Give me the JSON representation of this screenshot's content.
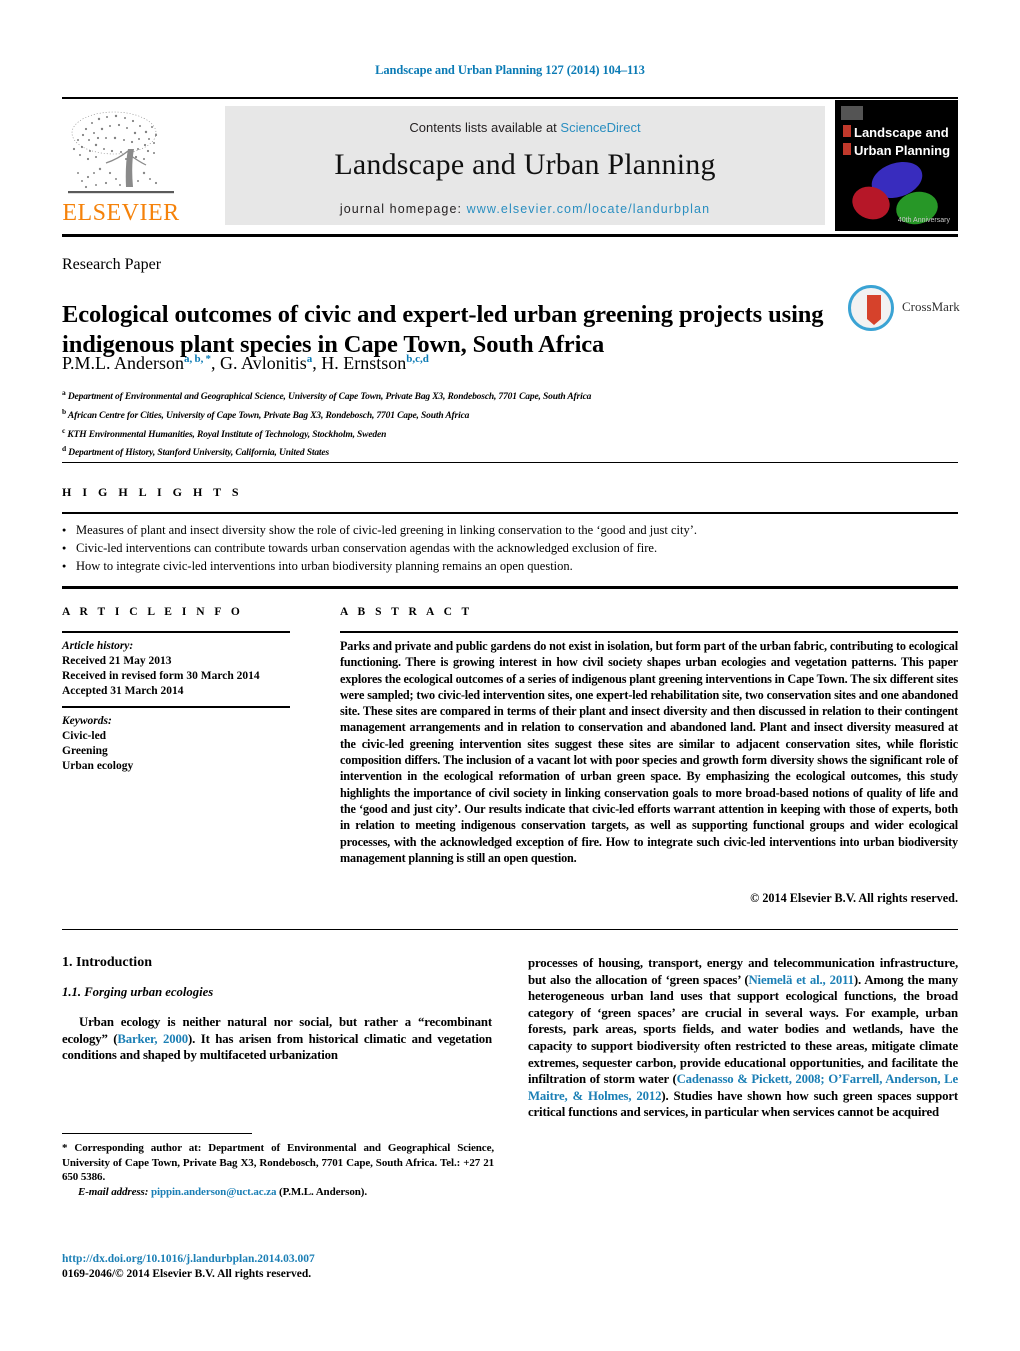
{
  "running_head": "Landscape and Urban Planning 127 (2014) 104–113",
  "masthead": {
    "contents_prefix": "Contents lists available at ",
    "contents_link": "ScienceDirect",
    "journal_title": "Landscape and Urban Planning",
    "homepage_label": "journal homepage: ",
    "homepage_url": "www.elsevier.com/locate/landurbplan",
    "publisher_logo_text": "ELSEVIER",
    "cover": {
      "line1": "Landscape and",
      "line2": "Urban Planning",
      "anniversary": "40th Anniversary"
    },
    "colors": {
      "link": "#2a8ec0",
      "elsevier_orange": "#f5820a",
      "panel_bg": "#e7e7e7"
    }
  },
  "article": {
    "type": "Research Paper",
    "title": "Ecological outcomes of civic and expert-led urban greening projects using indigenous plant species in Cape Town, South Africa",
    "crossmark_label": "CrossMark",
    "authors_html": "P.M.L. Anderson<sup>a, b, *</sup>, G. Avlonitis<sup>a</sup>, H. Ernstson<sup>b,c,d</sup>",
    "affiliations": [
      {
        "marker": "a",
        "text": "Department of Environmental and Geographical Science, University of Cape Town, Private Bag X3, Rondebosch, 7701 Cape, South Africa"
      },
      {
        "marker": "b",
        "text": "African Centre for Cities, University of Cape Town, Private Bag X3, Rondebosch, 7701 Cape, South Africa"
      },
      {
        "marker": "c",
        "text": "KTH Environmental Humanities, Royal Institute of Technology, Stockholm, Sweden"
      },
      {
        "marker": "d",
        "text": "Department of History, Stanford University, California, United States"
      }
    ]
  },
  "highlights": {
    "heading": "H I G H L I G H T S",
    "items": [
      "Measures of plant and insect diversity show the role of civic-led greening in linking conservation to the ‘good and just city’.",
      "Civic-led interventions can contribute towards urban conservation agendas with the acknowledged exclusion of fire.",
      "How to integrate civic-led interventions into urban biodiversity planning remains an open question."
    ]
  },
  "article_info": {
    "heading": "A R T I C L E   I N F O",
    "history_label": "Article history:",
    "history": [
      "Received 21 May 2013",
      "Received in revised form 30 March 2014",
      "Accepted 31 March 2014"
    ],
    "keywords_label": "Keywords:",
    "keywords": [
      "Civic-led",
      "Greening",
      "Urban ecology"
    ]
  },
  "abstract": {
    "heading": "A B S T R A C T",
    "text": "Parks and private and public gardens do not exist in isolation, but form part of the urban fabric, contributing to ecological functioning. There is growing interest in how civil society shapes urban ecologies and vegetation patterns. This paper explores the ecological outcomes of a series of indigenous plant greening interventions in Cape Town. The six different sites were sampled; two civic-led intervention sites, one expert-led rehabilitation site, two conservation sites and one abandoned site. These sites are compared in terms of their plant and insect diversity and then discussed in relation to their contingent management arrangements and in relation to conservation and abandoned land. Plant and insect diversity measured at the civic-led greening intervention sites suggest these sites are similar to adjacent conservation sites, while floristic composition differs. The inclusion of a vacant lot with poor species and growth form diversity shows the significant role of intervention in the ecological reformation of urban green space. By emphasizing the ecological outcomes, this study highlights the importance of civil society in linking conservation goals to more broad-based notions of quality of life and the ‘good and just city’. Our results indicate that civic-led efforts warrant attention in keeping with those of experts, both in relation to meeting indigenous conservation targets, as well as supporting functional groups and wider ecological processes, with the acknowledged exception of fire. How to integrate such civic-led interventions into urban biodiversity management planning is still an open question.",
    "copyright": "© 2014 Elsevier B.V. All rights reserved."
  },
  "body": {
    "section_number_title": "1.  Introduction",
    "subsection_number_title": "1.1.  Forging urban ecologies",
    "left_paragraph_pre": "Urban ecology is neither natural nor social, but rather a “recombinant ecology” (",
    "left_paragraph_ref": "Barker, 2000",
    "left_paragraph_post": "). It has arisen from historical climatic and vegetation conditions and shaped by multifaceted urbanization",
    "right_p1_pre": "processes of housing, transport, energy and telecommunication infrastructure, but also the allocation of ‘green spaces’ (",
    "right_p1_ref": "Niemelä et al., 2011",
    "right_p1_post": "). Among the many heterogeneous urban land uses that support ecological functions, the broad category of ‘green spaces’ are crucial in several ways. For example, urban forests, park areas, sports fields, and water bodies and wetlands, have the capacity to support biodiversity often restricted to these areas, mitigate climate extremes, sequester carbon, provide educational opportunities, and facilitate the infiltration of storm water (",
    "right_p1_ref2": "Cadenasso & Pickett, 2008; O’Farrell, Anderson, Le Maitre, & Holmes, 2012",
    "right_p1_post2": "). Studies have shown how such green spaces support critical functions and services, in particular when services cannot be acquired"
  },
  "footnotes": {
    "corresponding": "*  Corresponding author at: Department of Environmental and Geographical Science, University of Cape Town, Private Bag X3, Rondebosch, 7701 Cape, South Africa. Tel.: +27 21 650 5386.",
    "email_label": "E-mail address:",
    "email": "pippin.anderson@uct.ac.za",
    "email_owner": "(P.M.L. Anderson).",
    "doi": "http://dx.doi.org/10.1016/j.landurbplan.2014.03.007",
    "issn_line": "0169-2046/© 2014 Elsevier B.V. All rights reserved."
  }
}
